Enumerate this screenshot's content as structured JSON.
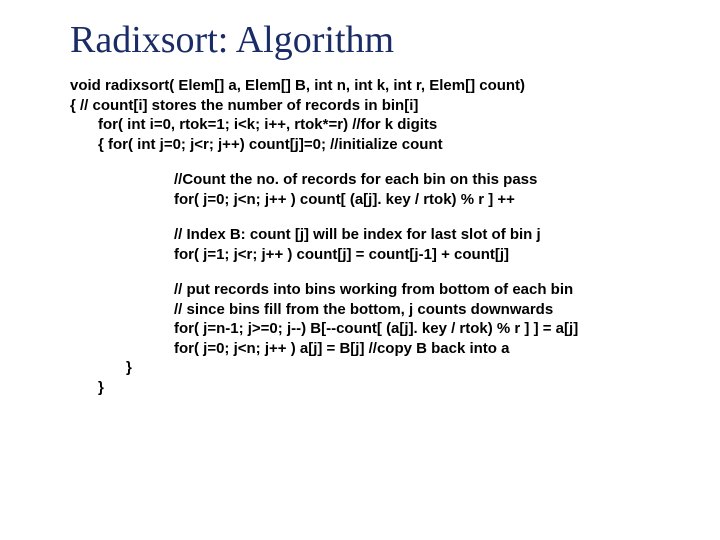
{
  "title": "Radixsort: Algorithm",
  "lines": {
    "sig": "void radixsort( Elem[] a, Elem[] B, int n, int k, int r, Elem[] count)",
    "open": "{    // count[i] stores the number of records in bin[i]",
    "for_outer": "for( int i=0, rtok=1; i<k; i++, rtok*=r) //for k digits",
    "init": "{         for( int j=0; j<r; j++)    count[j]=0;  //initialize count",
    "cmt_count1": "//Count the no. of records for each bin on this pass",
    "cmt_count2": "for( j=0; j<n; j++ )    count[ (a[j]. key / rtok) % r ] ++",
    "cmt_index1": "// Index B: count [j] will be index for last slot of bin j",
    "cmt_index2": "for( j=1; j<r; j++ )  count[j] = count[j-1] + count[j]",
    "cmt_put1": "// put records into bins working from bottom of each bin",
    "cmt_put2": "// since bins fill from the bottom, j counts downwards",
    "cmt_put3": "for( j=n-1; j>=0; j--) B[--count[ (a[j]. key / rtok) % r ] ] = a[j]",
    "cmt_put4": "for( j=0; j<n; j++ ) a[j] = B[j]    //copy B back into a",
    "close_inner": "}",
    "close_outer": "}"
  }
}
